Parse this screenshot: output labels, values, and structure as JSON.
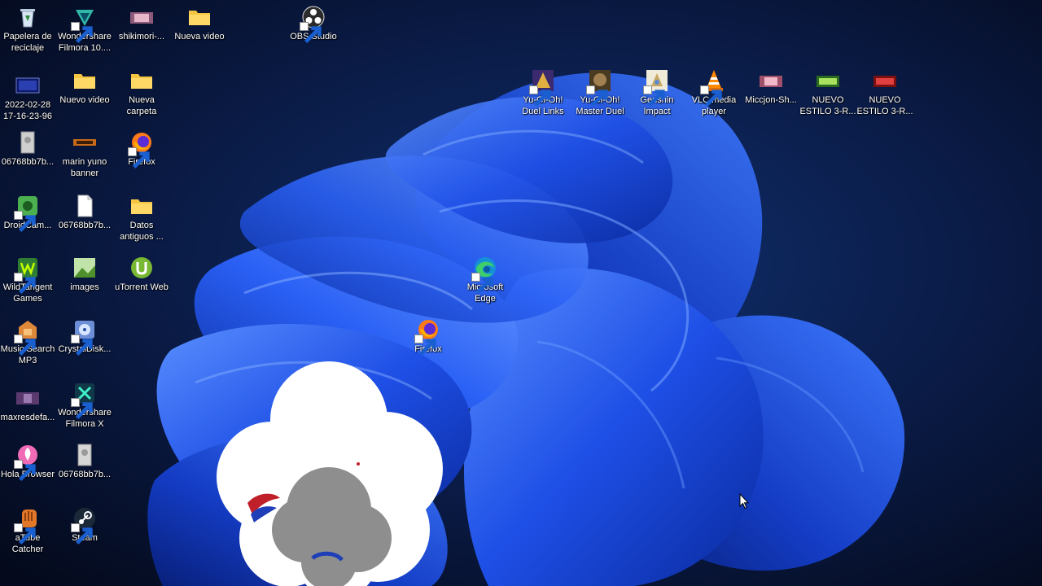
{
  "desktop": {
    "icons": {
      "recycle_bin": "Papelera de\nreciclaje",
      "filmora10": "Wondershare\nFilmora 10....",
      "shikimori": "shikimori-...",
      "nueva_video": "Nueva video",
      "obs": "OBS Studio",
      "capture_2022": "2022-02-28\n17-16-23-96",
      "nuevo_video": "Nuevo video",
      "nueva_carpeta": "Nueva\ncarpeta",
      "file_06768_1": "06768bb7b...",
      "marin_banner": "marin yuno\nbanner",
      "firefox_left": "Firefox",
      "droidcam": "DroidCam...",
      "file_06768_2": "06768bb7b...",
      "datos_antiguos": "Datos\nantiguos ...",
      "wildtangent": "WildTangent\nGames",
      "images": "images",
      "utorrent": "uTorrent Web",
      "music_search": "Music Search\nMP3",
      "crystaldisk": "CrystalDisk...",
      "maxresdefault": "maxresdefa...",
      "filmora_x": "Wondershare\nFilmora X",
      "hola_browser": "Hola Browser",
      "file_06768_3": "06768bb7b...",
      "atube": "aTube\nCatcher",
      "steam": "Steam",
      "yugioh_duel_links": "Yu-Gi-Oh!\nDuel Links",
      "yugioh_master_duel": "Yu-Gi-Oh!\nMaster Duel",
      "genshin": "Genshin\nImpact",
      "vlc": "VLC media\nplayer",
      "miccjon": "Miccjon-Sh...",
      "nuevo_estilo_1": "NUEVO\nESTILO 3-R...",
      "nuevo_estilo_2": "NUEVO\nESTILO 3-R...",
      "edge": "Microsoft\nEdge",
      "firefox_center": "Firefox"
    }
  },
  "colors": {
    "background": "#050d24",
    "bloom_primary": "#1a4ff0",
    "bloom_light": "#4d86ff",
    "folder": "#f5c542",
    "label_text": "#ffffff"
  }
}
